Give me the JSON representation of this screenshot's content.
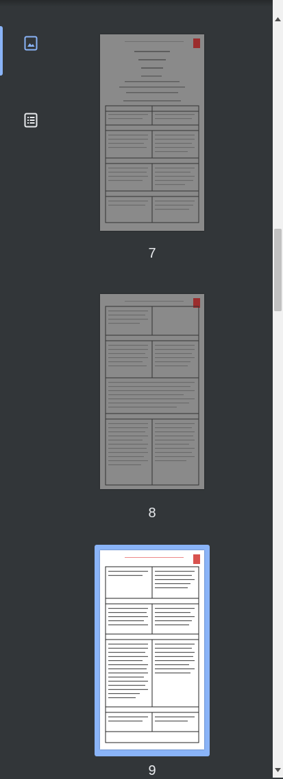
{
  "sidebar": {
    "thumbnails_tab": {
      "icon": "image-icon",
      "active": true
    },
    "outline_tab": {
      "icon": "list-icon",
      "active": false
    },
    "accent_color": "#8ab4f8"
  },
  "pages": [
    {
      "label": "7",
      "selected": false
    },
    {
      "label": "8",
      "selected": false
    },
    {
      "label": "9",
      "selected": true
    }
  ],
  "scrollbar": {
    "position": 0.34
  }
}
